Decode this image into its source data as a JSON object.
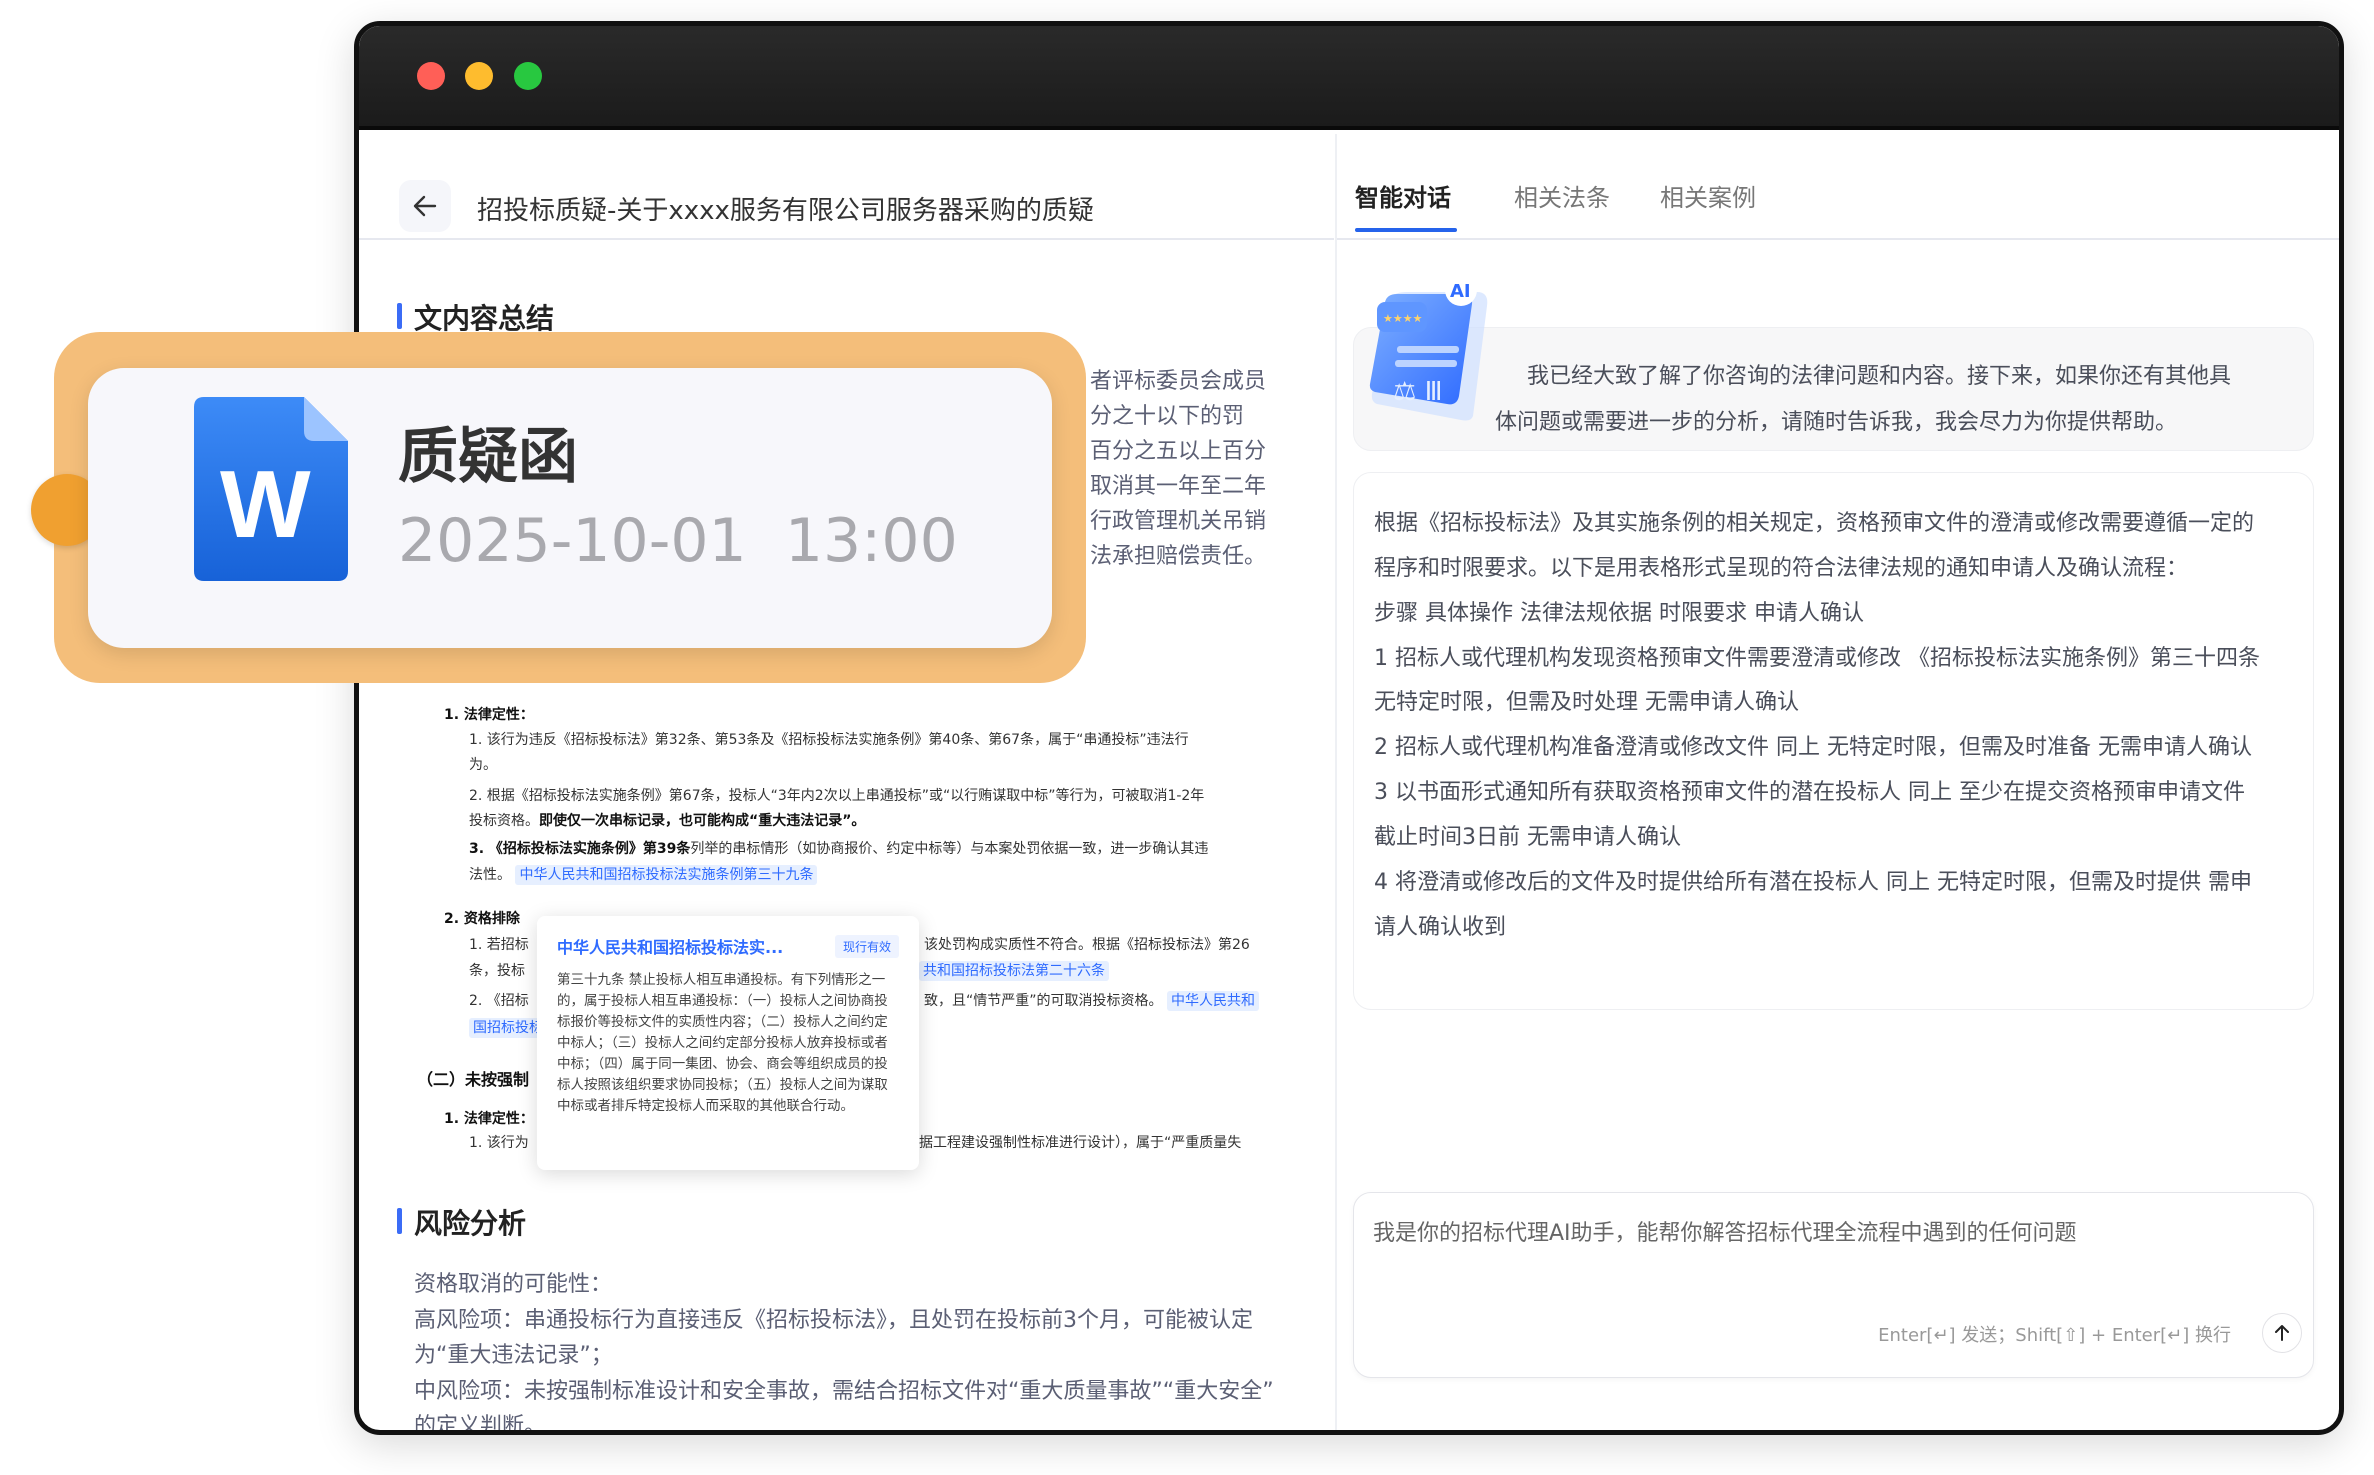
{
  "window": {
    "traffic_lights": [
      "#ff5f57",
      "#febc2e",
      "#28c840"
    ]
  },
  "document": {
    "title": "招投标质疑-关于xxxx服务有限公司服务器采购的质疑",
    "section_summary": "文内容总结",
    "summary_visible_lines": [
      "者评标委员会成员",
      "分之十以下的罚",
      "百分之五以上百分",
      "取消其一年至二年",
      "行政管理机关吊销",
      "法承担赔偿责任。"
    ],
    "embedded": {
      "h1": "1. 法律定性：",
      "l1a": "1. 该行为违反《招标投标法》第32条、第53条及《招标投标法实施条例》第40条、第67条，属于“串通投标”违法行",
      "l1b": "为。",
      "l2a": "2. 根据《招标投标法实施条例》第67条，投标人“3年内2次以上串通投标”或“以行贿谋取中标”等行为，可被取消1-2年",
      "l2b_plain": "投标资格。",
      "l2b_bold": "即使仅一次串标记录，也可能构成“重大违法记录”。",
      "l3a_bold": "3. 《招标投标法实施条例》第39条",
      "l3a_plain": "列举的串标情形（如协商报价、约定中标等）与本案处罚依据一致，进一步确认其违",
      "l3b": "法性。",
      "tag1": "中华人民共和国招标投标法实施条例第三十九条",
      "h2": "2. 资格排除",
      "l4_left": "1. 若招标",
      "l4_right": "该处罚构成实质性不符合。根据《招标投标法》第26",
      "l5_left": "条，投标",
      "tag2": "共和国招标投标法第二十六条",
      "l6_left": "2. 《招标",
      "l6_right": "致，且“情节严重”的可取消投标资格。",
      "tag3a": "中华人民共和",
      "tag3b": "国招标投标",
      "h3": "（二）未按强制",
      "h4": "1. 法律定性：",
      "l7_left": "1. 该行为",
      "l7_right": "据工程建设强制性标准进行设计），属于“严重质量失"
    },
    "popup": {
      "title": "中华人民共和国招标投标法实...",
      "status": "现行有效",
      "body": "第三十九条 禁止投标人相互串通投标。有下列情形之一的，属于投标人相互串通投标：（一）投标人之间协商投标报价等投标文件的实质性内容；（二）投标人之间约定中标人；（三）投标人之间约定部分投标人放弃投标或者中标；（四）属于同一集团、协会、商会等组织成员的投标人按照该组织要求协同投标；（五）投标人之间为谋取中标或者排斥特定投标人而采取的其他联合行动。"
    },
    "section_risk": "风险分析",
    "risk_lines": [
      "资格取消的可能性：",
      "高风险项：串通投标行为直接违反《招标投标法》，且处罚在投标前3个月，可能被认定",
      "为“重大违法记录”；",
      "中风险项：未按强制标准设计和安全事故，需结合招标文件对“重大质量事故”“重大安全”",
      "的定义判断。"
    ]
  },
  "file_card": {
    "name": "质疑函",
    "datetime": "2025-10-01  13:00",
    "icon": "word-document-icon",
    "accent": "#f4be7a",
    "dot": "#f0a030"
  },
  "chat": {
    "tabs": [
      {
        "label": "智能对话",
        "active": true
      },
      {
        "label": "相关法条"
      },
      {
        "label": "相关案例"
      }
    ],
    "greeting_lines": [
      "我已经大致了解了你咨询的法律问题和内容。接下来，如果你还有其他具",
      "体问题或需要进一步的分析，请随时告诉我，我会尽力为你提供帮助。"
    ],
    "answer_lines": [
      "根据《招标投标法》及其实施条例的相关规定，资格预审文件的澄清或修改需要遵循一定的",
      "程序和时限要求。以下是用表格形式呈现的符合法律法规的通知申请人及确认流程：",
      "步骤  具体操作  法律法规依据  时限要求  申请人确认",
      "1  招标人或代理机构发现资格预审文件需要澄清或修改  《招标投标法实施条例》第三十四条",
      "无特定时限，但需及时处理  无需申请人确认",
      "2  招标人或代理机构准备澄清或修改文件  同上  无特定时限，但需及时准备  无需申请人确认",
      "3  以书面形式通知所有获取资格预审文件的潜在投标人  同上  至少在提交资格预审申请文件",
      "截止时间3日前  无需申请人确认",
      "4  将澄清或修改后的文件及时提供给所有潜在投标人  同上  无特定时限，但需及时提供  需申",
      "请人确认收到"
    ],
    "input_placeholder": "我是你的招标代理AI助手，能帮你解答招标代理全流程中遇到的任何问题",
    "input_hint": "Enter[↵] 发送；Shift[⇧] + Enter[↵] 换行",
    "accent": "#2563eb"
  }
}
